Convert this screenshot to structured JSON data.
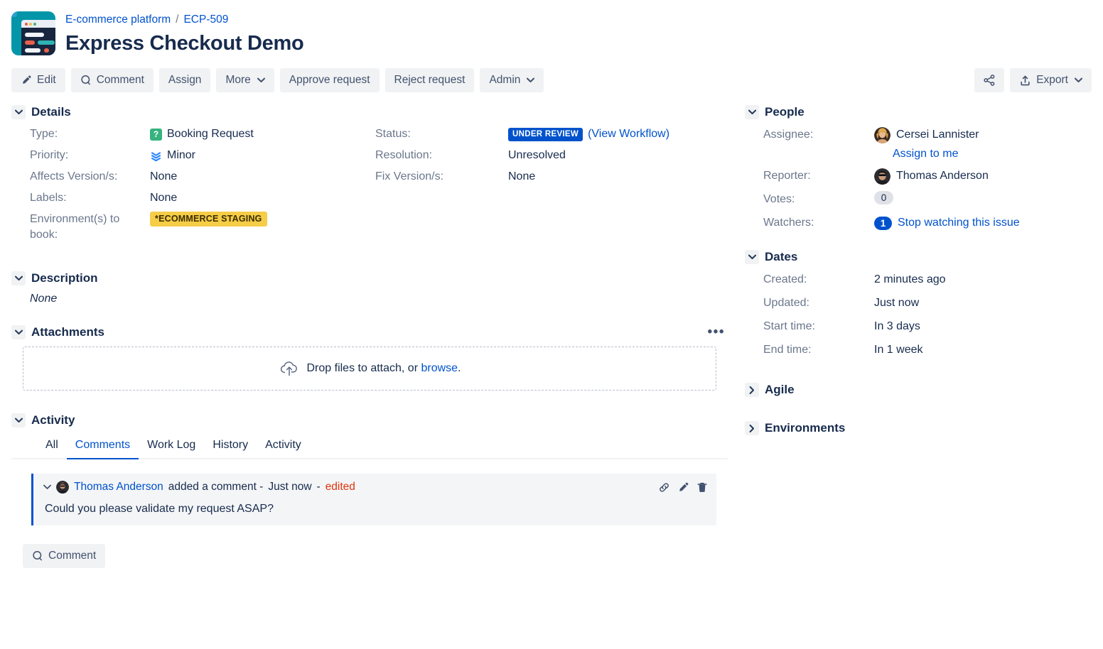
{
  "header": {
    "project_icon": "project-browser-icon",
    "breadcrumb": {
      "project": "E-commerce platform",
      "separator": "/",
      "issue_key": "ECP-509"
    },
    "title": "Express Checkout Demo"
  },
  "toolbar": {
    "edit": "Edit",
    "comment": "Comment",
    "assign": "Assign",
    "more": "More",
    "approve": "Approve request",
    "reject": "Reject request",
    "admin": "Admin",
    "share_icon": "share-icon",
    "export": "Export"
  },
  "details": {
    "heading": "Details",
    "left": [
      {
        "label": "Type:",
        "value": "Booking Request",
        "icon": "booking-request-type-icon"
      },
      {
        "label": "Priority:",
        "value": "Minor",
        "icon": "minor-priority-icon"
      },
      {
        "label": "Affects Version/s:",
        "value": "None"
      },
      {
        "label": "Labels:",
        "value": "None"
      },
      {
        "label": "Environment(s) to book:",
        "value": "*ECOMMERCE STAGING",
        "badge": true
      }
    ],
    "right": [
      {
        "label": "Status:",
        "value": "UNDER REVIEW",
        "link": "(View Workflow)"
      },
      {
        "label": "Resolution:",
        "value": "Unresolved"
      },
      {
        "label": "Fix Version/s:",
        "value": "None"
      }
    ]
  },
  "description": {
    "heading": "Description",
    "body": "None"
  },
  "attachments": {
    "heading": "Attachments",
    "more_label": "•••",
    "drop_text": "Drop files to attach, or ",
    "browse_label": "browse",
    "drop_text_end": ".",
    "upload_icon": "cloud-upload-icon"
  },
  "activity": {
    "heading": "Activity",
    "tabs": [
      {
        "label": "All",
        "active": false
      },
      {
        "label": "Comments",
        "active": true
      },
      {
        "label": "Work Log",
        "active": false
      },
      {
        "label": "History",
        "active": false
      },
      {
        "label": "Activity",
        "active": false
      }
    ],
    "comment": {
      "author": "Thomas Anderson",
      "action": "added a comment -",
      "time": "Just now",
      "dash": "-",
      "edited": "edited",
      "body": "Could you please validate my request ASAP?",
      "actions": [
        "link-icon",
        "edit-pencil-icon",
        "delete-trash-icon"
      ]
    },
    "footer_comment_button": "Comment"
  },
  "people": {
    "heading": "People",
    "assignee_label": "Assignee:",
    "assignee": "Cersei Lannister",
    "assign_to_me": "Assign to me",
    "reporter_label": "Reporter:",
    "reporter": "Thomas Anderson",
    "votes_label": "Votes:",
    "votes": "0",
    "watchers_label": "Watchers:",
    "watchers": "1",
    "watch_link": "Stop watching this issue"
  },
  "dates": {
    "heading": "Dates",
    "rows": [
      {
        "label": "Created:",
        "value": "2 minutes ago"
      },
      {
        "label": "Updated:",
        "value": "Just now"
      },
      {
        "label": "Start time:",
        "value": "In 3 days"
      },
      {
        "label": "End time:",
        "value": "In 1 week"
      }
    ]
  },
  "agile": {
    "heading": "Agile"
  },
  "environments": {
    "heading": "Environments"
  },
  "colors": {
    "link": "#0052cc",
    "status_badge": "#0052cc",
    "env_badge": "#f5cd47",
    "type_icon": "#36b37e",
    "priority_icon": "#2684ff",
    "edited": "#de350b",
    "button_bg": "#f1f2f4",
    "text": "#172b4d",
    "muted": "#6b778c",
    "project_icon_bg": "#0496a8"
  }
}
